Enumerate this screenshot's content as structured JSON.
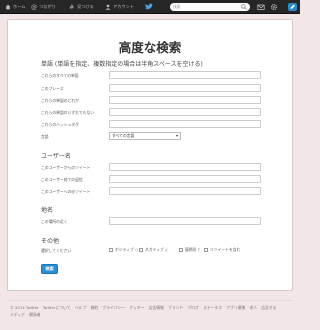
{
  "nav": {
    "home": "ホーム",
    "connect": "つながり",
    "discover": "見つける",
    "account": "アカウント",
    "search_placeholder": "検索"
  },
  "page": {
    "title": "高度な検索"
  },
  "words": {
    "title": "単語 (単語を指定、複数指定の場合は半角スペースを空ける)",
    "rows": [
      "これらのすべての単語",
      "このフレーズ",
      "これらの単語のどれか",
      "これらの単語のいずれでもない",
      "これらのハッシュタグ",
      "言語"
    ],
    "language_value": "すべての言語"
  },
  "users": {
    "title": "ユーザー名",
    "rows": [
      "このユーザーからのツイート",
      "このユーザー宛ての返信",
      "このユーザーへの@ツイート"
    ]
  },
  "place": {
    "title": "地名",
    "rows": [
      "この場所の近く"
    ]
  },
  "other": {
    "title": "その他",
    "label": "選択してください",
    "options": [
      "ポジティブ :)",
      "ネガティブ :(",
      "疑問形 ?",
      "リツイートを含む"
    ]
  },
  "search_button": "検索",
  "footer": {
    "line1": [
      "© 2014 Twitter",
      "Twitterについて",
      "ヘルプ",
      "規約",
      "プライバシー",
      "クッキー",
      "広告情報",
      "ブランド",
      "ブログ",
      "ステータス",
      "アプリ連携",
      "求人",
      "広告する"
    ],
    "line2": [
      "メディア",
      "開発者"
    ]
  },
  "colors": {
    "background": "#f3e6e6",
    "topbar": "#262626",
    "accent": "#2b8fd1"
  }
}
